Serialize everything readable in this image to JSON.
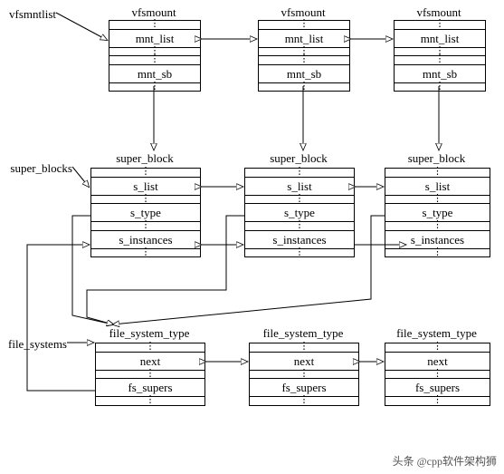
{
  "labels": {
    "vfsmntlist": "vfsmntlist",
    "super_blocks": "super_blocks",
    "file_systems": "file_systems"
  },
  "vfsmount": {
    "title": "vfsmount",
    "fields": {
      "mnt_list": "mnt_list",
      "mnt_sb": "mnt_sb"
    }
  },
  "super_block": {
    "title": "super_block",
    "fields": {
      "s_list": "s_list",
      "s_type": "s_type",
      "s_instances": "s_instances"
    }
  },
  "file_system_type": {
    "title": "file_system_type",
    "fields": {
      "next": "next",
      "fs_supers": "fs_supers"
    }
  },
  "dots": "⋮",
  "watermark": "头条 @cpp软件架构狮"
}
